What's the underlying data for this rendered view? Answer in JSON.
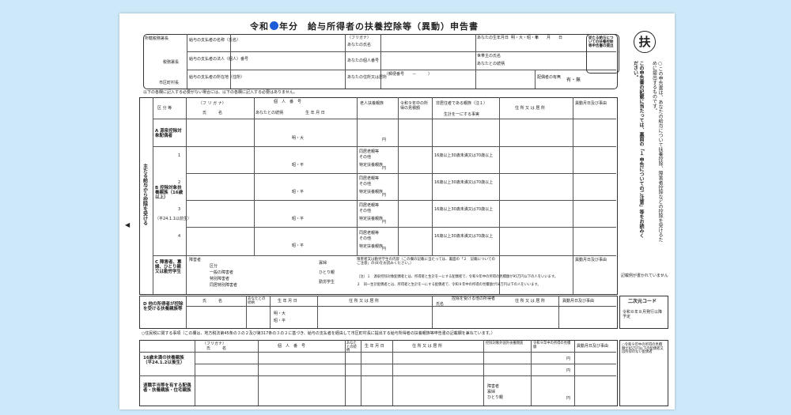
{
  "form": {
    "title_prefix": "令和",
    "title_rest": "年分　給与所得者の扶養控除等（異動）申告書",
    "stamp": "扶",
    "header_left": [
      "所轄税務署長",
      "税務署長",
      "市区町村長"
    ],
    "header_mid": [
      "給与の支払者の名称（氏名）",
      "給与の支払者の法人（個人）番号",
      "給与の支払者の所在地（住所）"
    ],
    "header_right": [
      "（フリガナ）",
      "あなたの氏名",
      "あなたの個人番号",
      "あなたの住所又は居所",
      "（郵便番号　　－　　　）"
    ],
    "header_far": [
      "あなたの生年月日",
      "世帯主の氏名",
      "あなたとの続柄",
      "配偶者の有無",
      "有・無",
      "明・大・昭・平",
      "年　　月　　日"
    ],
    "side_note_box": "従たる給与についての扶養控除等申告書の提出",
    "notice": "以下の各欄に記入する必要がない場合には、以下の各欄に記入する必要はありません。",
    "col_headers": [
      "区 分 等",
      "（フ リ ガ ナ）",
      "氏　　　名",
      "個　人　番　号",
      "あなたとの続柄",
      "生 年 月 日",
      "老人扶養親族",
      "令和９年中の所得の見積額",
      "非居住者である親族（注１）",
      "生計を一にする事実",
      "住 所 又 は 居 所",
      "異動月日及び事由"
    ],
    "section_a": "A 源泉控除対象配偶者",
    "section_b": "B 控除対象扶養親族（16歳以上）",
    "section_b_sub": "（平24.1.1以前生）",
    "section_c": "C 障害者、寡婦、ひとり親又は勤労学生",
    "section_d": "D 他の所得者が控除を受ける扶養親族等",
    "side_label": "主たる給与から控除を受ける",
    "row_numbers": [
      "1",
      "2",
      "3",
      "4"
    ],
    "era_short": [
      "明・大",
      "昭・平"
    ],
    "yen": "円",
    "checks_b": [
      "同居老親等",
      "その他",
      "特定扶養親族"
    ],
    "checks_nr": [
      "16歳以上30歳未満又は70歳以上",
      "留学",
      "障害者",
      "38万円以上の支払"
    ],
    "c_labels": [
      "障害者",
      "区分",
      "一般の障害者",
      "特別障害者",
      "同居特別障害者",
      "寡婦",
      "ひとり親",
      "勤労学生"
    ],
    "c_note": "障害者又は勤労学生の内容（この欄の記載に当たっては、裏面の「２　記載についてのご注意」の(8)をお読みください。）",
    "c_footnotes": [
      "（注）１　源泉控除対象配偶者とは、所得者と生計を一にする配偶者で、令和９年中の所得の見積額が95万円以下の人をいいます。",
      "２　同一生計配偶者とは、所得者と生計を一にする配偶者で、令和９年中の所得の見積額が58万円以下の人をいいます。"
    ],
    "d_headers": [
      "氏　　　名",
      "あなたとの続柄",
      "生 年 月 日",
      "住 所 又 は 居 所",
      "控除を受ける他の所得者",
      "氏名",
      "あなたとの続柄",
      "住 所 又 は 居 所",
      "異動月日及び事由"
    ],
    "nijigen": "二次元コード",
    "nijigen_sub": "令和８年８月発行以降予定",
    "resident_note": "○住民税に関する事項（この欄は、地方税法第45条の３の２及び第317条の３の２に基づき、給与の支払者を経由して市区町村長に提出する給与所得者の扶養親族等申告書の記載欄を兼ねています。）",
    "e1_label": "16歳未満の扶養親族（平24.1.2以後生）",
    "e2_label": "退職手当等を有する配偶者・扶養親族・住宅親族",
    "e_headers": [
      "（フリガナ）",
      "氏　　　名",
      "個　人　番　号",
      "あなたとの続柄",
      "生 年 月 日",
      "住 所 又 は 居 所",
      "控除対象外国外扶養親族",
      "令和９年中の所得の見積額",
      "異動月日及び事由"
    ],
    "e_checks": [
      "障害者",
      "寡婦",
      "ひとり親"
    ],
    "right_note_main": "○この申告書は、あなたの給与について扶養控除、障害者控除などの控除を受けるために提出するものです。",
    "right_note_bold": "この申告書の記載に当たっては、裏面の「１ 申告についてのご注意」等をお読みください。",
    "right_note_side": "記載例が書かれていません",
    "right_note_bottom": "○令和９年中の所得の見積額が95万円以下の配偶者又は所得のない配偶者"
  },
  "colors": {
    "background": "#cde8f8",
    "paper": "#ffffff",
    "dot": "#1d5bd8",
    "ink": "#222222"
  }
}
